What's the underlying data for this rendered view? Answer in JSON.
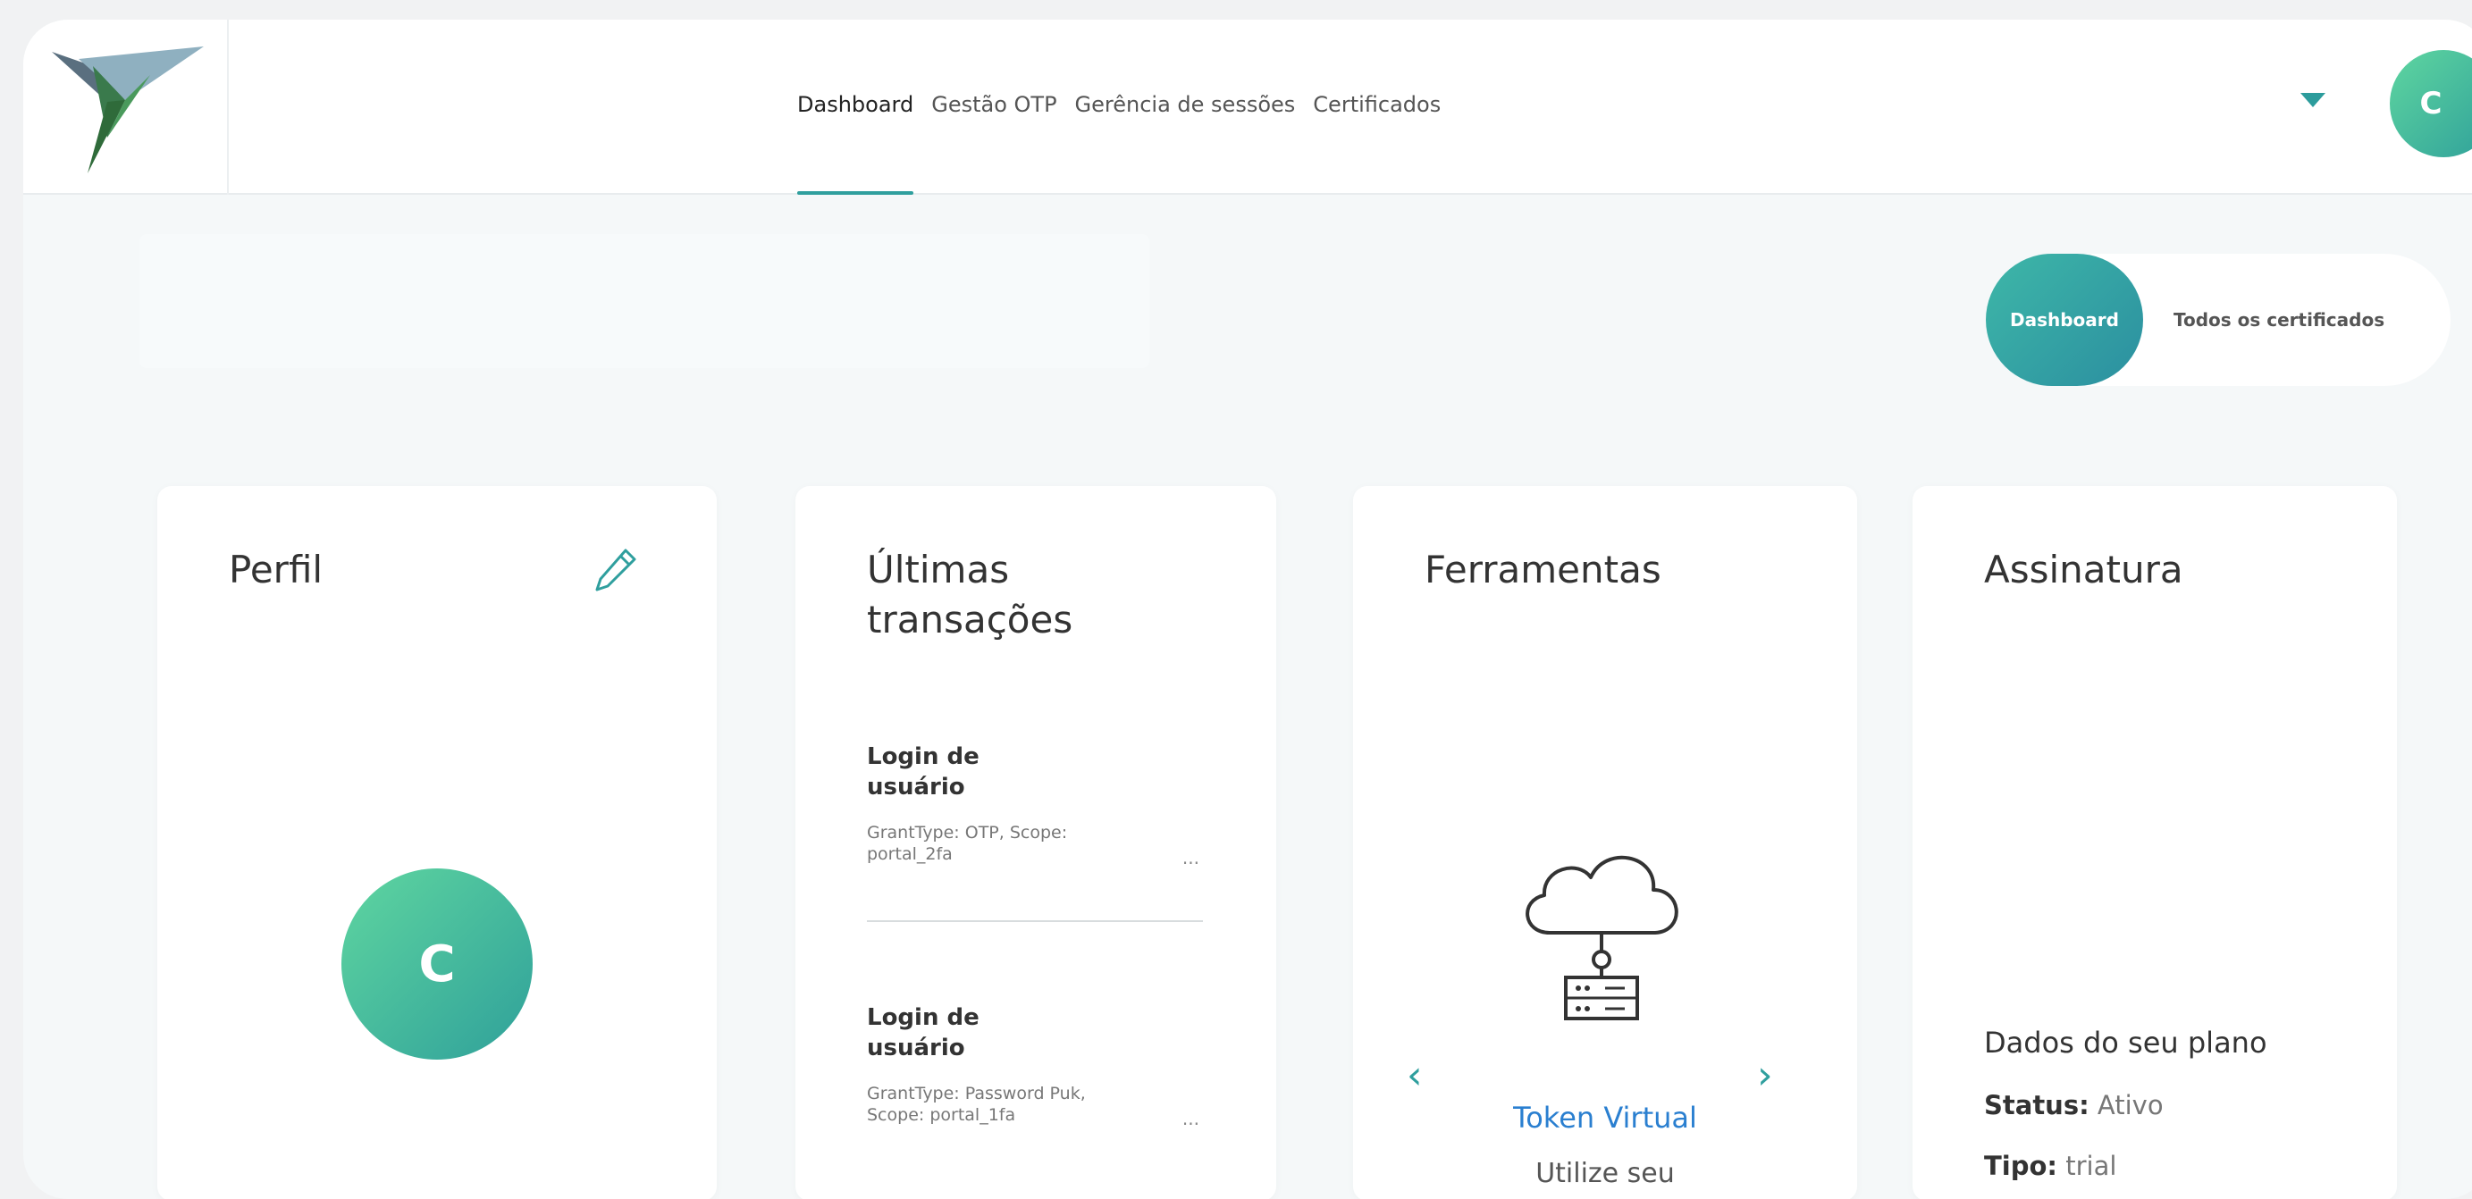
{
  "colors": {
    "accent": "#2f9f9e",
    "avatar_gradient_start": "#5fd6a0",
    "avatar_gradient_end": "#2fa09a",
    "link": "#2a7fd0"
  },
  "nav": {
    "items": [
      {
        "label": "Dashboard",
        "active": true
      },
      {
        "label": "Gestão OTP",
        "active": false
      },
      {
        "label": "Gerência de sessões",
        "active": false
      },
      {
        "label": "Certificados",
        "active": false
      }
    ]
  },
  "user": {
    "avatar_initial": "C",
    "menu_icon": "caret-down-icon"
  },
  "view_toggle": {
    "active_label": "Dashboard",
    "other_label": "Todos os certificados"
  },
  "profile_card": {
    "title": "Perfil",
    "edit_icon": "pencil-icon",
    "avatar_initial": "C"
  },
  "transactions_card": {
    "title_line1": "Últimas",
    "title_line2": "transações",
    "items": [
      {
        "title_line1": "Login de",
        "title_line2": "usuário",
        "desc_line1": "GrantType: OTP, Scope:",
        "desc_line2": "portal_2fa",
        "more": "..."
      },
      {
        "title_line1": "Login de",
        "title_line2": "usuário",
        "desc_line1": "GrantType: Password Puk,",
        "desc_line2": "Scope: portal_1fa",
        "more": "..."
      }
    ]
  },
  "tools_card": {
    "title": "Ferramentas",
    "icon": "cloud-server-icon",
    "tool_name": "Token Virtual",
    "tool_desc": "Utilize seu",
    "prev": "‹",
    "next": "›"
  },
  "subscription_card": {
    "title": "Assinatura",
    "plan_heading": "Dados do seu plano",
    "status_label": "Status:",
    "status_value": "Ativo",
    "type_label": "Tipo:",
    "type_value": "trial"
  }
}
